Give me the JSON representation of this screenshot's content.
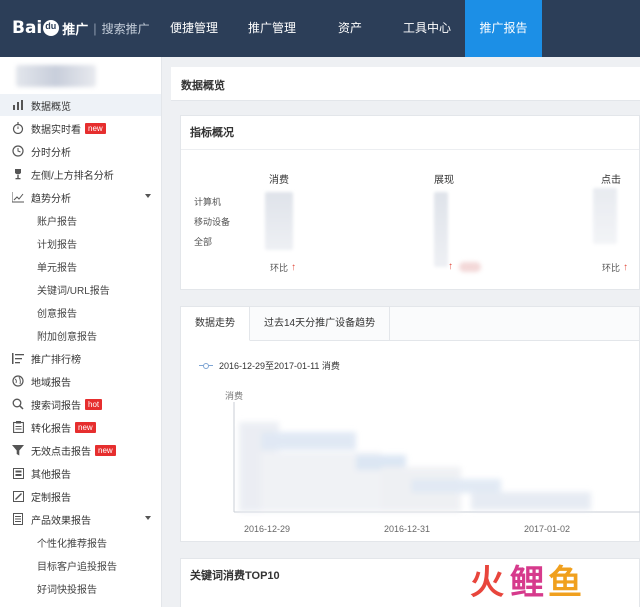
{
  "header": {
    "logo_text": "Bai",
    "logo_suffix": "推广",
    "logo_sub": "搜索推广",
    "nav": [
      {
        "label": "便捷管理"
      },
      {
        "label": "推广管理"
      },
      {
        "label": "资产"
      },
      {
        "label": "工具中心"
      },
      {
        "label": "推广报告",
        "active": true
      }
    ],
    "active_color": "#1c8fe6",
    "bar_color": "#2c3e58"
  },
  "sidebar": {
    "items": [
      {
        "label": "数据概览",
        "icon": "bar-chart-icon",
        "active": true
      },
      {
        "label": "数据实时看",
        "icon": "stopwatch-icon",
        "badge": "new"
      },
      {
        "label": "分时分析",
        "icon": "clock-icon"
      },
      {
        "label": "左侧/上方排名分析",
        "icon": "trophy-icon"
      },
      {
        "label": "趋势分析",
        "icon": "line-chart-icon",
        "expanded": true
      },
      {
        "label": "账户报告",
        "child": true
      },
      {
        "label": "计划报告",
        "child": true
      },
      {
        "label": "单元报告",
        "child": true
      },
      {
        "label": "关键词/URL报告",
        "child": true
      },
      {
        "label": "创意报告",
        "child": true
      },
      {
        "label": "附加创意报告",
        "child": true
      },
      {
        "label": "推广排行榜",
        "icon": "list-rank-icon"
      },
      {
        "label": "地域报告",
        "icon": "globe-icon"
      },
      {
        "label": "搜索词报告",
        "icon": "search-icon",
        "badge": "hot"
      },
      {
        "label": "转化报告",
        "icon": "clipboard-icon",
        "badge": "new"
      },
      {
        "label": "无效点击报告",
        "icon": "filter-icon",
        "badge": "new"
      },
      {
        "label": "其他报告",
        "icon": "grid-icon"
      },
      {
        "label": "定制报告",
        "icon": "edit-icon"
      },
      {
        "label": "产品效果报告",
        "icon": "document-icon",
        "expanded": true
      },
      {
        "label": "个性化推荐报告",
        "child": true
      },
      {
        "label": "目标客户追投报告",
        "child": true
      },
      {
        "label": "好词快投报告",
        "child": true
      }
    ],
    "badge_color": "#e62e2e"
  },
  "main": {
    "page_title": "数据概览",
    "overview": {
      "title": "指标概况",
      "columns": [
        "消费",
        "展现",
        "点击"
      ],
      "rows": [
        "计算机",
        "移动设备",
        "全部"
      ],
      "ratio_label": "环比",
      "trend_up_color": "#e14a3c"
    },
    "trend": {
      "tabs": [
        "数据走势",
        "过去14天分推广设备趋势"
      ],
      "legend": "2016-12-29至2017-01-11 消费",
      "y_label": "消费",
      "x_ticks": [
        "2016-12-29",
        "2016-12-31",
        "2017-01-02"
      ]
    },
    "keywords": {
      "title": "关键词消费TOP10"
    }
  },
  "watermark": {
    "chars": [
      "火",
      "鲤",
      "鱼"
    ],
    "colors": [
      "#e8453c",
      "#d63a8c",
      "#f0a01e"
    ]
  }
}
